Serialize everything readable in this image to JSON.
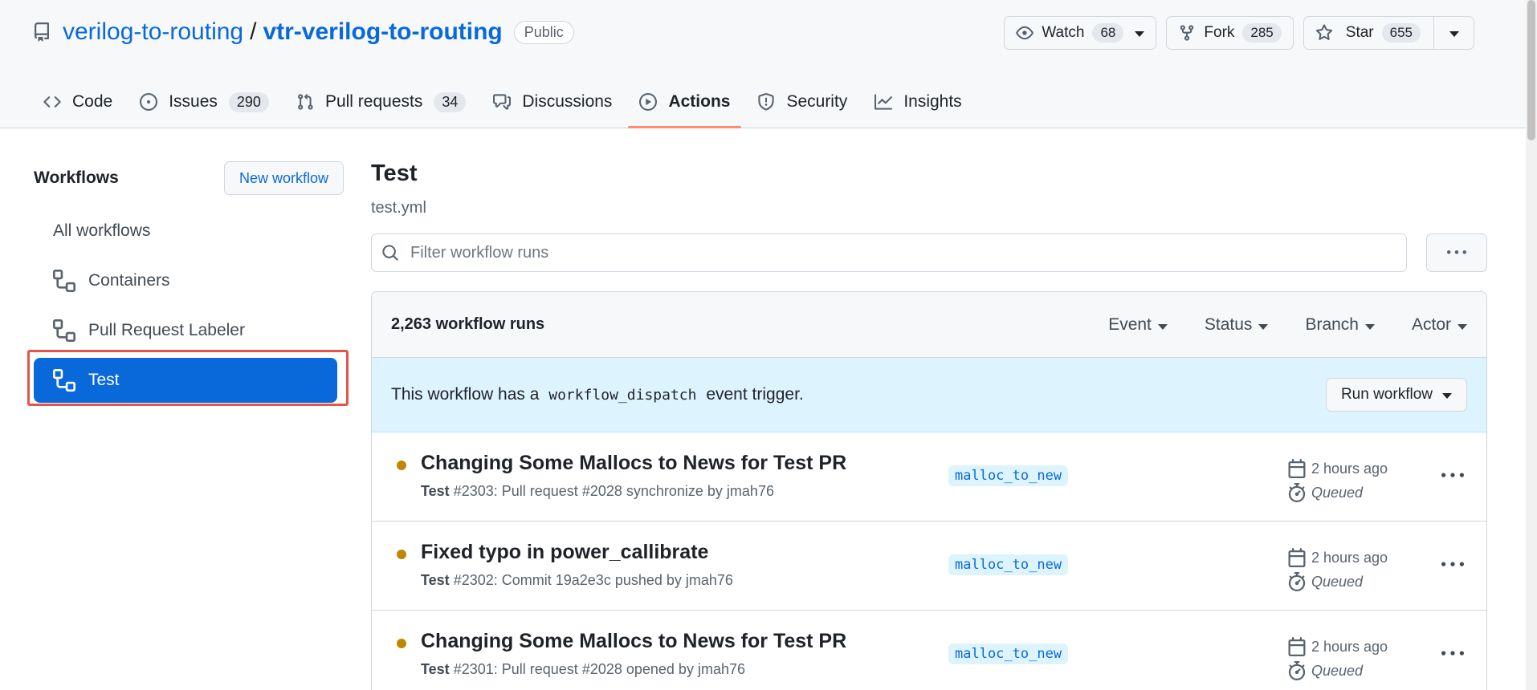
{
  "repo": {
    "owner": "verilog-to-routing",
    "separator": "/",
    "name": "vtr-verilog-to-routing",
    "visibility": "Public"
  },
  "repo_actions": {
    "watch_label": "Watch",
    "watch_count": "68",
    "fork_label": "Fork",
    "fork_count": "285",
    "star_label": "Star",
    "star_count": "655"
  },
  "tabs": [
    {
      "label": "Code",
      "icon": "code-icon"
    },
    {
      "label": "Issues",
      "count": "290",
      "icon": "issue-icon"
    },
    {
      "label": "Pull requests",
      "count": "34",
      "icon": "pull-request-icon"
    },
    {
      "label": "Discussions",
      "icon": "discussion-icon"
    },
    {
      "label": "Actions",
      "icon": "play-icon",
      "active": true
    },
    {
      "label": "Security",
      "icon": "shield-icon"
    },
    {
      "label": "Insights",
      "icon": "graph-icon"
    }
  ],
  "sidebar": {
    "title": "Workflows",
    "new_workflow": "New workflow",
    "items": [
      {
        "label": "All workflows"
      },
      {
        "label": "Containers",
        "icon": "workflow-icon"
      },
      {
        "label": "Pull Request Labeler",
        "icon": "workflow-icon"
      },
      {
        "label": "Test",
        "icon": "workflow-icon",
        "active": true
      }
    ]
  },
  "main": {
    "title": "Test",
    "file": "test.yml",
    "filter_placeholder": "Filter workflow runs",
    "runs_count": "2,263 workflow runs",
    "filters": [
      "Event",
      "Status",
      "Branch",
      "Actor"
    ],
    "dispatch": {
      "before": "This workflow has a",
      "code": "workflow_dispatch",
      "after": "event trigger.",
      "button": "Run workflow"
    },
    "runs": [
      {
        "title": "Changing Some Mallocs to News for Test PR",
        "workflow": "Test",
        "detail": "#2303: Pull request #2028 synchronize by jmah76",
        "branch": "malloc_to_new",
        "time": "2 hours ago",
        "status": "Queued"
      },
      {
        "title": "Fixed typo in power_callibrate",
        "workflow": "Test",
        "detail": "#2302: Commit 19a2e3c pushed by jmah76",
        "branch": "malloc_to_new",
        "time": "2 hours ago",
        "status": "Queued"
      },
      {
        "title": "Changing Some Mallocs to News for Test PR",
        "workflow": "Test",
        "detail": "#2301: Pull request #2028 opened by jmah76",
        "branch": "malloc_to_new",
        "time": "2 hours ago",
        "status": "Queued"
      }
    ]
  },
  "colors": {
    "link": "#0969da",
    "active_tab_underline": "#fd8c73",
    "queued_dot": "#bf8700",
    "selection_outline": "#e5534b"
  }
}
